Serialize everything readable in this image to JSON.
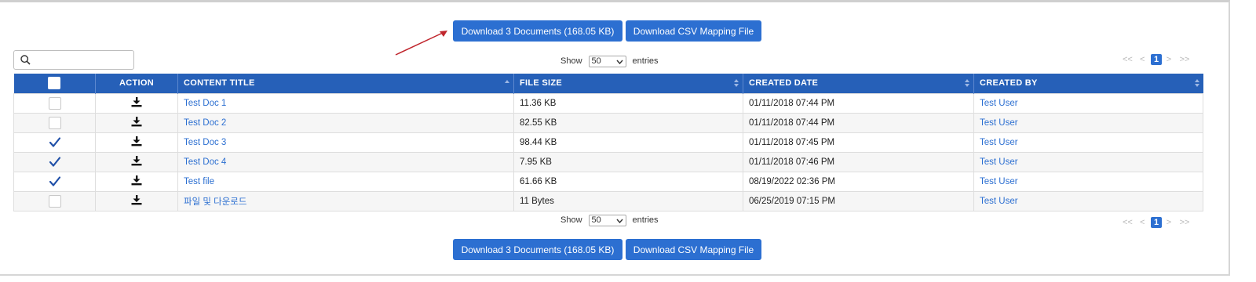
{
  "buttons": {
    "download_docs": "Download 3 Documents (168.05 KB)",
    "download_csv": "Download CSV Mapping File"
  },
  "search": {
    "placeholder": "",
    "value": ""
  },
  "length": {
    "show": "Show",
    "value": "50",
    "entries": "entries"
  },
  "pager": {
    "first": "<<",
    "prev": "<",
    "current": "1",
    "next": ">",
    "last": ">>"
  },
  "table": {
    "headers": [
      "ACTION",
      "CONTENT TITLE",
      "FILE SIZE",
      "CREATED DATE",
      "CREATED BY"
    ],
    "rows": [
      {
        "checked": false,
        "title": "Test Doc 1",
        "size": "11.36 KB",
        "date": "01/11/2018 07:44 PM",
        "by": "Test User"
      },
      {
        "checked": false,
        "title": "Test Doc 2",
        "size": "82.55 KB",
        "date": "01/11/2018 07:44 PM",
        "by": "Test User"
      },
      {
        "checked": true,
        "title": "Test Doc 3",
        "size": "98.44 KB",
        "date": "01/11/2018 07:45 PM",
        "by": "Test User"
      },
      {
        "checked": true,
        "title": "Test Doc 4",
        "size": "7.95 KB",
        "date": "01/11/2018 07:46 PM",
        "by": "Test User"
      },
      {
        "checked": true,
        "title": "Test file",
        "size": "61.66 KB",
        "date": "08/19/2022 02:36 PM",
        "by": "Test User"
      },
      {
        "checked": false,
        "title": "파일 및 다운로드",
        "size": "11 Bytes",
        "date": "06/25/2019 07:15 PM",
        "by": "Test User"
      }
    ]
  },
  "colors": {
    "accent": "#2c6fd1",
    "header": "#2660b8",
    "arrow": "#c0262d"
  },
  "icons": [
    "search-icon",
    "download-icon",
    "checkmark-icon",
    "sort-icon",
    "chevron-down-icon",
    "annotation-arrow"
  ]
}
